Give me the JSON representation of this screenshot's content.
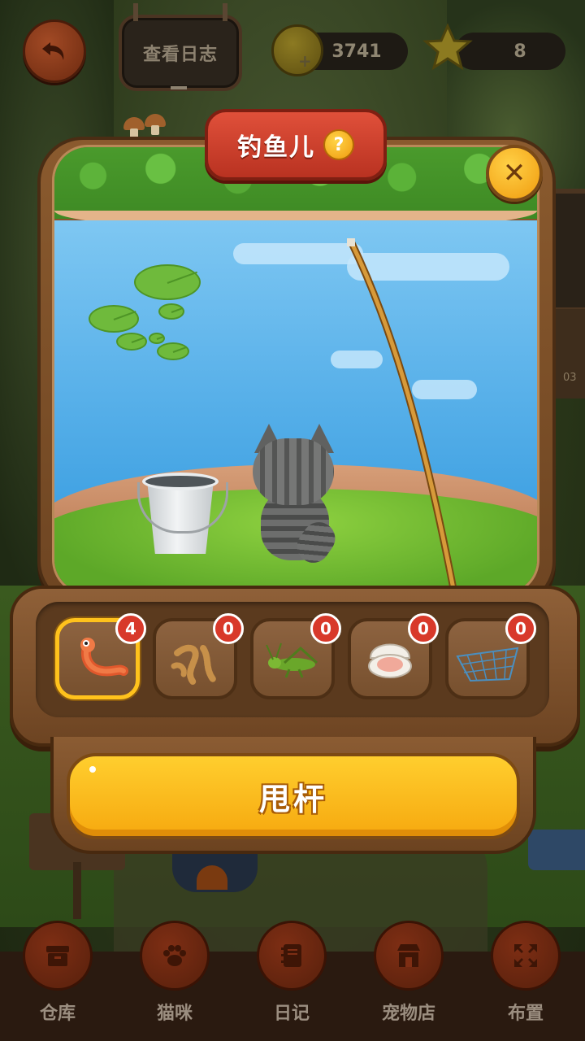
{
  "hud": {
    "log_label": "查看日志",
    "coins": "3741",
    "stars": "8"
  },
  "modal": {
    "title": "钓鱼儿",
    "help_icon": "?",
    "close_icon": "close-icon"
  },
  "baits": [
    {
      "name": "worm",
      "count": "4",
      "selected": true
    },
    {
      "name": "mealworms",
      "count": "0",
      "selected": false
    },
    {
      "name": "grasshopper",
      "count": "0",
      "selected": false
    },
    {
      "name": "clam",
      "count": "0",
      "selected": false
    },
    {
      "name": "fishing-net",
      "count": "0",
      "selected": false
    }
  ],
  "cast_button": "甩杆",
  "background_label": "03",
  "nav": [
    {
      "label": "仓库",
      "icon": "storage-box-icon"
    },
    {
      "label": "猫咪",
      "icon": "paw-icon"
    },
    {
      "label": "日记",
      "icon": "notebook-icon"
    },
    {
      "label": "宠物店",
      "icon": "shop-icon"
    },
    {
      "label": "布置",
      "icon": "arrange-icon"
    }
  ],
  "colors": {
    "accent_yellow": "#f6a90f",
    "title_red": "#c9392a",
    "badge_red": "#d8392a",
    "frame_brown": "#7a4d27",
    "pond_blue": "#5bb2ea"
  }
}
